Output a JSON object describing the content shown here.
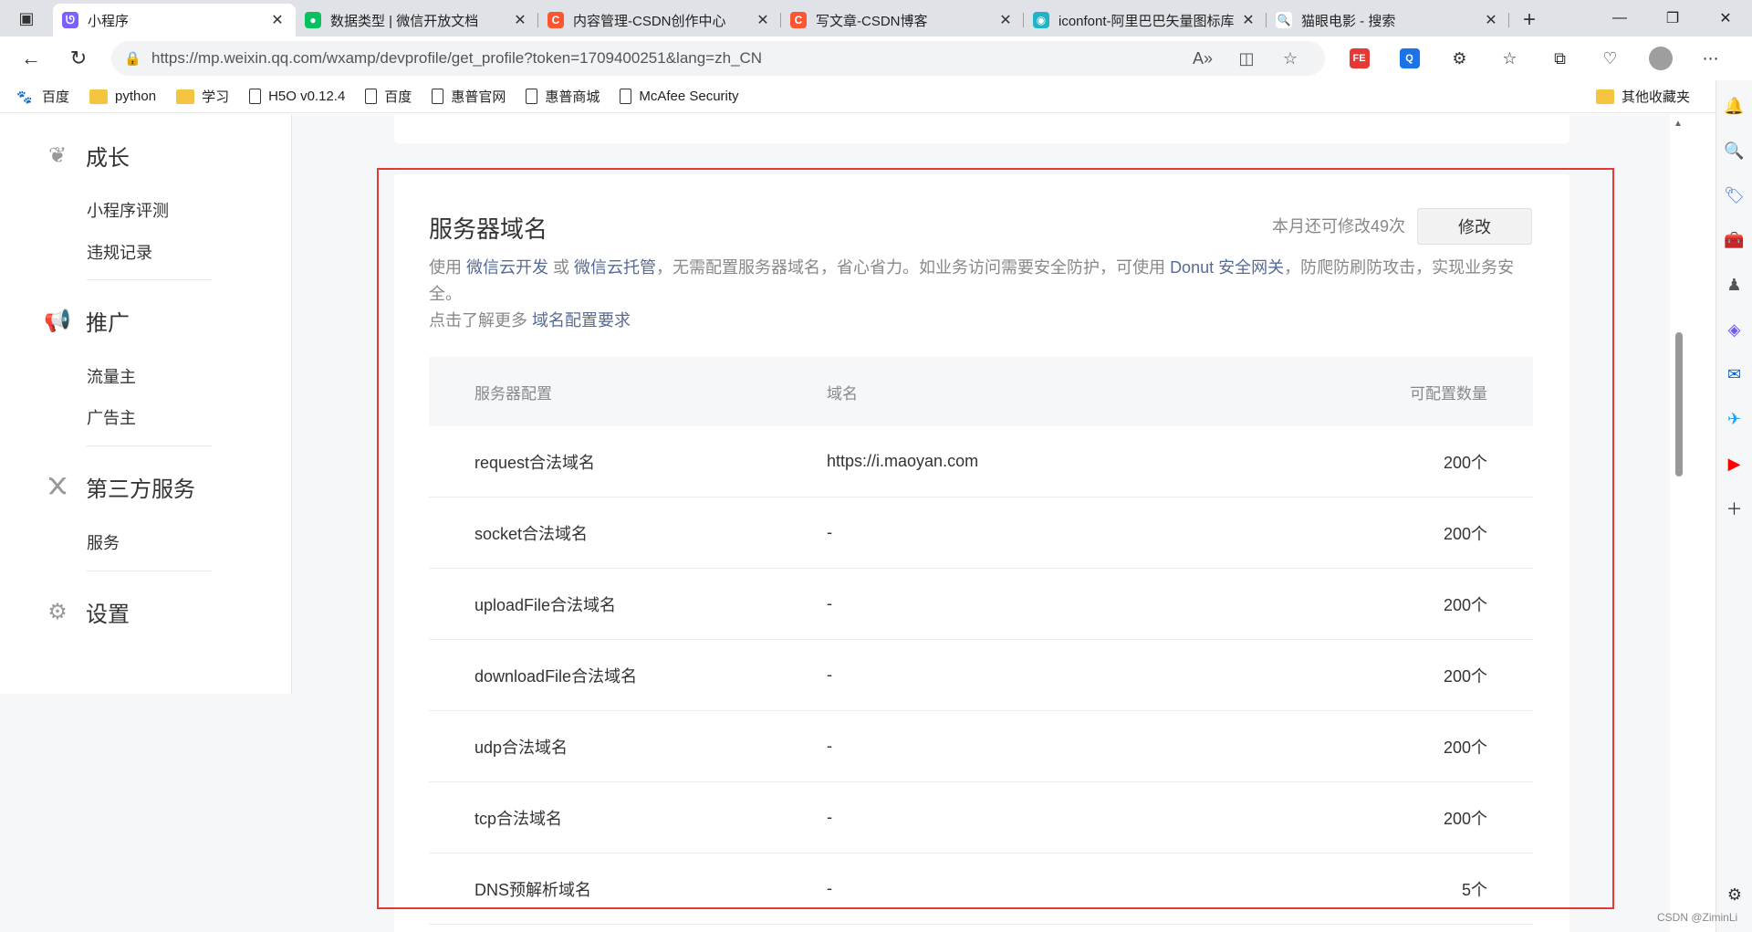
{
  "browser": {
    "tabs": [
      {
        "title": "小程序",
        "favicon_color": "#7b61ff",
        "favicon_glyph": "ᘎ",
        "active": true
      },
      {
        "title": "数据类型 | 微信开放文档",
        "favicon_color": "#07c160",
        "favicon_glyph": "●",
        "active": false
      },
      {
        "title": "内容管理-CSDN创作中心",
        "favicon_color": "#fc5531",
        "favicon_glyph": "C",
        "active": false
      },
      {
        "title": "写文章-CSDN博客",
        "favicon_color": "#fc5531",
        "favicon_glyph": "C",
        "active": false
      },
      {
        "title": "iconfont-阿里巴巴矢量图标库",
        "favicon_color": "#1fb4c7",
        "favicon_glyph": "◉",
        "active": false
      },
      {
        "title": "猫眼电影 - 搜索",
        "favicon_color": "#ffffff",
        "favicon_glyph": "🔍",
        "active": false
      }
    ],
    "url": "https://mp.weixin.qq.com/wxamp/devprofile/get_profile?token=1709400251&lang=zh_CN",
    "bookmarks": [
      {
        "label": "百度",
        "type": "baidu"
      },
      {
        "label": "python",
        "type": "folder"
      },
      {
        "label": "学习",
        "type": "folder"
      },
      {
        "label": "H5O v0.12.4",
        "type": "page"
      },
      {
        "label": "百度",
        "type": "page"
      },
      {
        "label": "惠普官网",
        "type": "page"
      },
      {
        "label": "惠普商城",
        "type": "page"
      },
      {
        "label": "McAfee Security",
        "type": "page"
      }
    ],
    "other_bookmarks": "其他收藏夹"
  },
  "sidebar": {
    "groups": [
      {
        "label": "成长",
        "icon": "sprout-icon",
        "items": [
          "小程序评测",
          "违规记录"
        ]
      },
      {
        "label": "推广",
        "icon": "megaphone-icon",
        "items": [
          "流量主",
          "广告主"
        ]
      },
      {
        "label": "第三方服务",
        "icon": "third-party-icon",
        "items": [
          "服务"
        ]
      },
      {
        "label": "设置",
        "icon": "gear-icon",
        "items": []
      }
    ]
  },
  "server_domain": {
    "title": "服务器域名",
    "quota_text": "本月还可修改49次",
    "modify_label": "修改",
    "desc": {
      "p1": "使用",
      "l1": "微信云开发",
      "p2": "或",
      "l2": "微信云托管",
      "p3": "，无需配置服务器域名，省心省力。如业务访问需要安全防护，可使用",
      "l3": "Donut 安全网关",
      "p4": "，防爬防刷防攻击，实现业务安全。",
      "p5": "点击了解更多",
      "l4": "域名配置要求"
    },
    "table": {
      "headers": [
        "服务器配置",
        "域名",
        "可配置数量"
      ],
      "rows": [
        [
          "request合法域名",
          "https://i.maoyan.com",
          "200个"
        ],
        [
          "socket合法域名",
          "-",
          "200个"
        ],
        [
          "uploadFile合法域名",
          "-",
          "200个"
        ],
        [
          "downloadFile合法域名",
          "-",
          "200个"
        ],
        [
          "udp合法域名",
          "-",
          "200个"
        ],
        [
          "tcp合法域名",
          "-",
          "200个"
        ],
        [
          "DNS预解析域名",
          "-",
          "5个"
        ]
      ]
    }
  },
  "watermark": "CSDN @ZiminLi"
}
